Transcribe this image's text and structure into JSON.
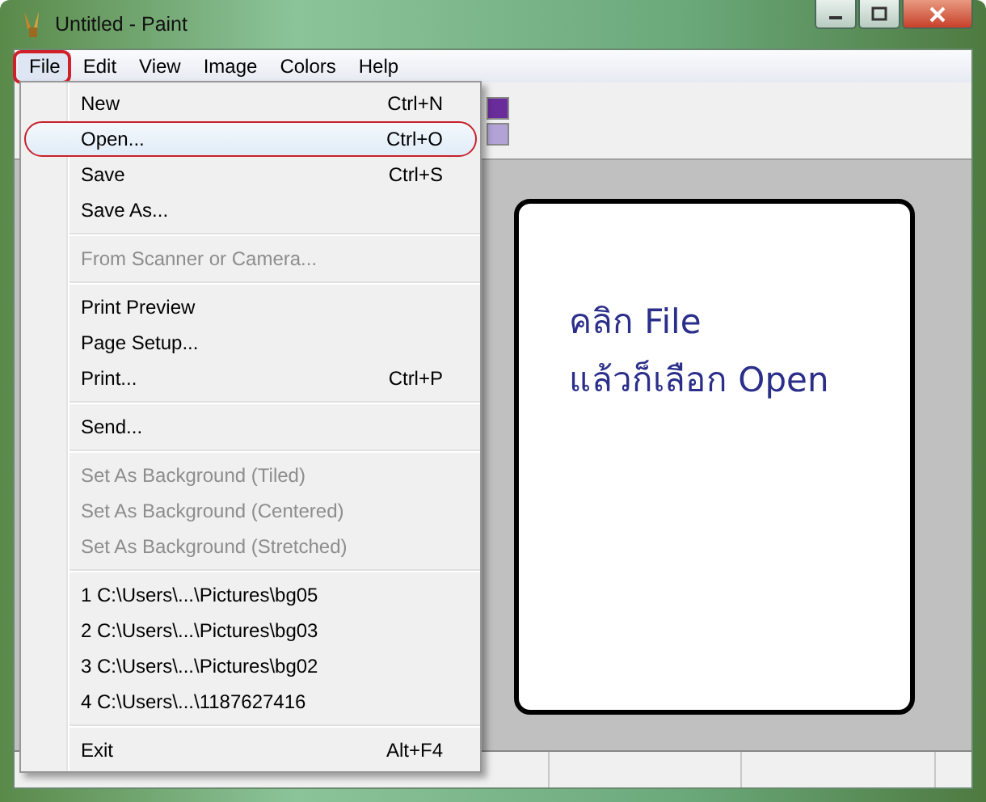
{
  "window": {
    "title": "Untitled - Paint"
  },
  "menu_bar": [
    {
      "label": "File",
      "selected": true
    },
    {
      "label": "Edit",
      "selected": false
    },
    {
      "label": "View",
      "selected": false
    },
    {
      "label": "Image",
      "selected": false
    },
    {
      "label": "Colors",
      "selected": false
    },
    {
      "label": "Help",
      "selected": false
    }
  ],
  "palette": [
    {
      "color": "#6a2c9a"
    },
    {
      "color": "#b3a2d6"
    }
  ],
  "file_menu": {
    "items": [
      {
        "kind": "item",
        "label": "New",
        "shortcut": "Ctrl+N",
        "disabled": false,
        "selected": false
      },
      {
        "kind": "item",
        "label": "Open...",
        "shortcut": "Ctrl+O",
        "disabled": false,
        "selected": true
      },
      {
        "kind": "item",
        "label": "Save",
        "shortcut": "Ctrl+S",
        "disabled": false,
        "selected": false
      },
      {
        "kind": "item",
        "label": "Save As...",
        "disabled": false,
        "selected": false
      },
      {
        "kind": "separator"
      },
      {
        "kind": "item",
        "label": "From Scanner or Camera...",
        "disabled": true,
        "selected": false
      },
      {
        "kind": "separator"
      },
      {
        "kind": "item",
        "label": "Print Preview",
        "disabled": false,
        "selected": false
      },
      {
        "kind": "item",
        "label": "Page Setup...",
        "disabled": false,
        "selected": false
      },
      {
        "kind": "item",
        "label": "Print...",
        "shortcut": "Ctrl+P",
        "disabled": false,
        "selected": false
      },
      {
        "kind": "separator"
      },
      {
        "kind": "item",
        "label": "Send...",
        "disabled": false,
        "selected": false
      },
      {
        "kind": "separator"
      },
      {
        "kind": "item",
        "label": "Set As Background (Tiled)",
        "disabled": true,
        "selected": false
      },
      {
        "kind": "item",
        "label": "Set As Background (Centered)",
        "disabled": true,
        "selected": false
      },
      {
        "kind": "item",
        "label": "Set As Background (Stretched)",
        "disabled": true,
        "selected": false
      },
      {
        "kind": "separator"
      },
      {
        "kind": "item",
        "label": "1 C:\\Users\\...\\Pictures\\bg05",
        "disabled": false,
        "selected": false
      },
      {
        "kind": "item",
        "label": "2 C:\\Users\\...\\Pictures\\bg03",
        "disabled": false,
        "selected": false
      },
      {
        "kind": "item",
        "label": "3 C:\\Users\\...\\Pictures\\bg02",
        "disabled": false,
        "selected": false
      },
      {
        "kind": "item",
        "label": "4 C:\\Users\\...\\1187627416",
        "disabled": false,
        "selected": false
      },
      {
        "kind": "separator"
      },
      {
        "kind": "item",
        "label": "Exit",
        "shortcut": "Alt+F4",
        "disabled": false,
        "selected": false
      }
    ]
  },
  "canvas": {
    "lines": [
      "คลิก  File",
      "แล้วก็เลือก  Open"
    ]
  }
}
